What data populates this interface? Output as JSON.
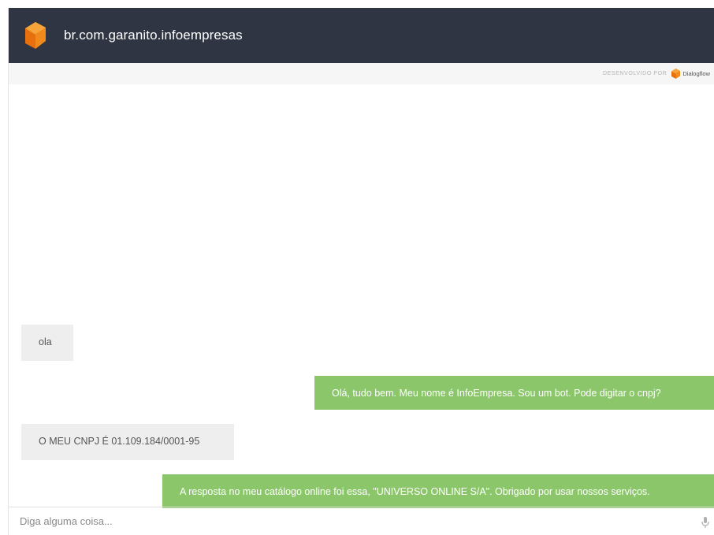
{
  "header": {
    "title": "br.com.garanito.infoempresas",
    "logo_icon": "agent-logo-icon",
    "background_color": "#2f3542"
  },
  "powered_by": {
    "label": "DESENVOLVIDO POR",
    "brand": "Dialogflow",
    "brand_icon": "dialogflow-logo-icon"
  },
  "messages": [
    {
      "role": "user",
      "text": "ola"
    },
    {
      "role": "bot",
      "text": "Olá, tudo bem. Meu nome é InfoEmpresa. Sou um bot. Pode digitar o cnpj?"
    },
    {
      "role": "user",
      "text": "O MEU CNPJ É 01.109.184/0001-95"
    },
    {
      "role": "bot",
      "text": "A resposta no meu catálogo online foi essa, \"UNIVERSO ONLINE S/A\". Obrigado por usar nossos serviços."
    }
  ],
  "colors": {
    "user_bubble": "#eeeeee",
    "bot_bubble": "#8bc76a",
    "accent": "#f39c12"
  },
  "input": {
    "placeholder": "Diga alguma coisa...",
    "value": "",
    "mic_icon": "microphone-icon"
  }
}
